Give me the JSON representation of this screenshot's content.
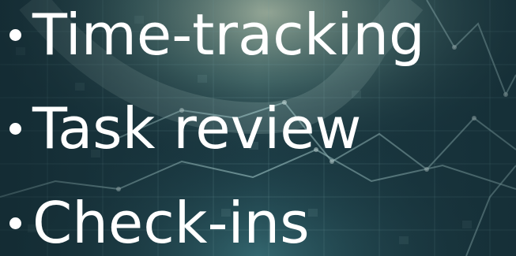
{
  "slide": {
    "background_colors": {
      "base": "#17313a",
      "teal": "#2d6b73",
      "highlight": "#8fb0b0",
      "gold": "#c9c08a"
    },
    "text_color": "#ffffff",
    "bullets": [
      {
        "text": "Time-tracking"
      },
      {
        "text": "Task review"
      },
      {
        "text": "Check-ins"
      }
    ]
  }
}
